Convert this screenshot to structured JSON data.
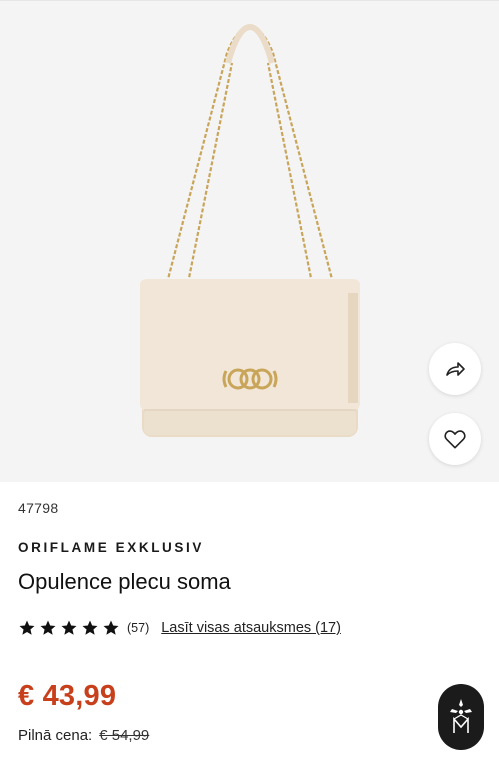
{
  "product": {
    "sku": "47798",
    "brand": "ORIFLAME EXKLUSIV",
    "title": "Opulence plecu soma",
    "rating": {
      "stars": 5,
      "count": "(57)",
      "reviews_link": "Lasīt visas atsauksmes (17)"
    },
    "price": "€ 43,99",
    "full_price_label": "Pilnā cena:",
    "full_price_value": "€ 54,99"
  },
  "icons": {
    "share": "share-icon",
    "favorite": "heart-icon",
    "star": "star-icon",
    "assistant": "assistant-logo-icon"
  },
  "colors": {
    "price": "#c8401b",
    "hero_bg": "#f4f4f4",
    "bag": "#efe3d3",
    "hardware": "#c9a55a"
  }
}
